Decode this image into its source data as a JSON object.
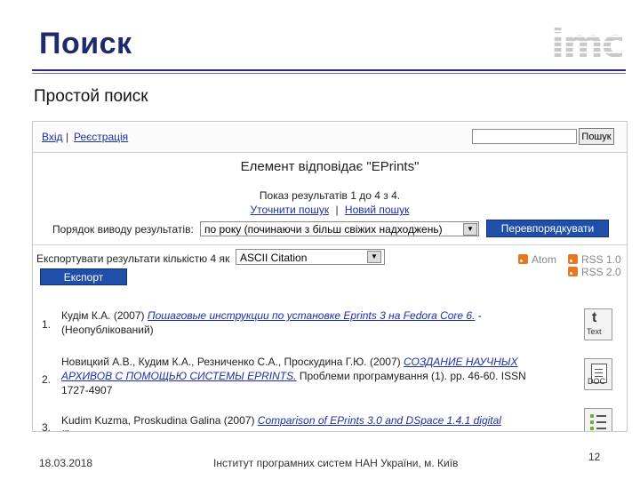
{
  "slide": {
    "title": "Поиск",
    "subtitle": "Простой поиск",
    "logo_text": "imc"
  },
  "header": {
    "login_label": "Вхід",
    "separator": "|",
    "register_label": "Реєстрація",
    "search_placeholder": "",
    "search_button": "Пошук"
  },
  "results": {
    "heading": "Елемент відповідає \"EPrints\"",
    "count_text": "Показ результатів 1 до 4 з 4.",
    "refine_label": "Уточнити пошук",
    "refine_separator": "|",
    "new_search_label": "Новий пошук",
    "order_label": "Порядок виводу результатів:",
    "order_value": "по року (починаючи з більш свіжих надходжень)",
    "reorder_button": "Перевпорядкувати"
  },
  "export": {
    "label": "Експортувати результати кількістю 4 як",
    "format_value": "ASCII Citation",
    "button": "Експорт",
    "feeds": [
      {
        "label": "Atom"
      },
      {
        "label": "RSS 1.0"
      },
      {
        "label": "RSS 2.0"
      }
    ]
  },
  "items": [
    {
      "num": "1.",
      "authors": "Кудім К.А. (2007)",
      "title": "Пошаговые инструкции по установке Eprints 3 на Fedora Core 6.",
      "rest": " - (Неопублікований)",
      "icon": "text-file-icon",
      "icon_label": "Text",
      "icon_glyph": "t"
    },
    {
      "num": "2.",
      "authors": "Новицкий А.В., Кудим К.А., Резниченко С.А., Проскудина Г.Ю. (2007)",
      "title": "СОЗДАНИЕ НАУЧНЫХ АРХИВОВ С ПОМОЩЬЮ СИСТЕМЫ EPRINTS.",
      "rest": " Проблеми програмування (1). pp. 46-60. ISSN 1727-4907",
      "icon": "doc-file-icon",
      "icon_label": "DOC"
    },
    {
      "num": "3.",
      "authors": "Kudim Kuzma, Proskudina Galina (2007)",
      "title": "Comparison of EPrints 3.0 and DSpace 1.4.1 digital library",
      "rest": "",
      "icon": "list-file-icon"
    }
  ],
  "footer": {
    "date": "18.03.2018",
    "institute": "Інститут програмних систем НАН України, м. Київ",
    "page": "12"
  }
}
